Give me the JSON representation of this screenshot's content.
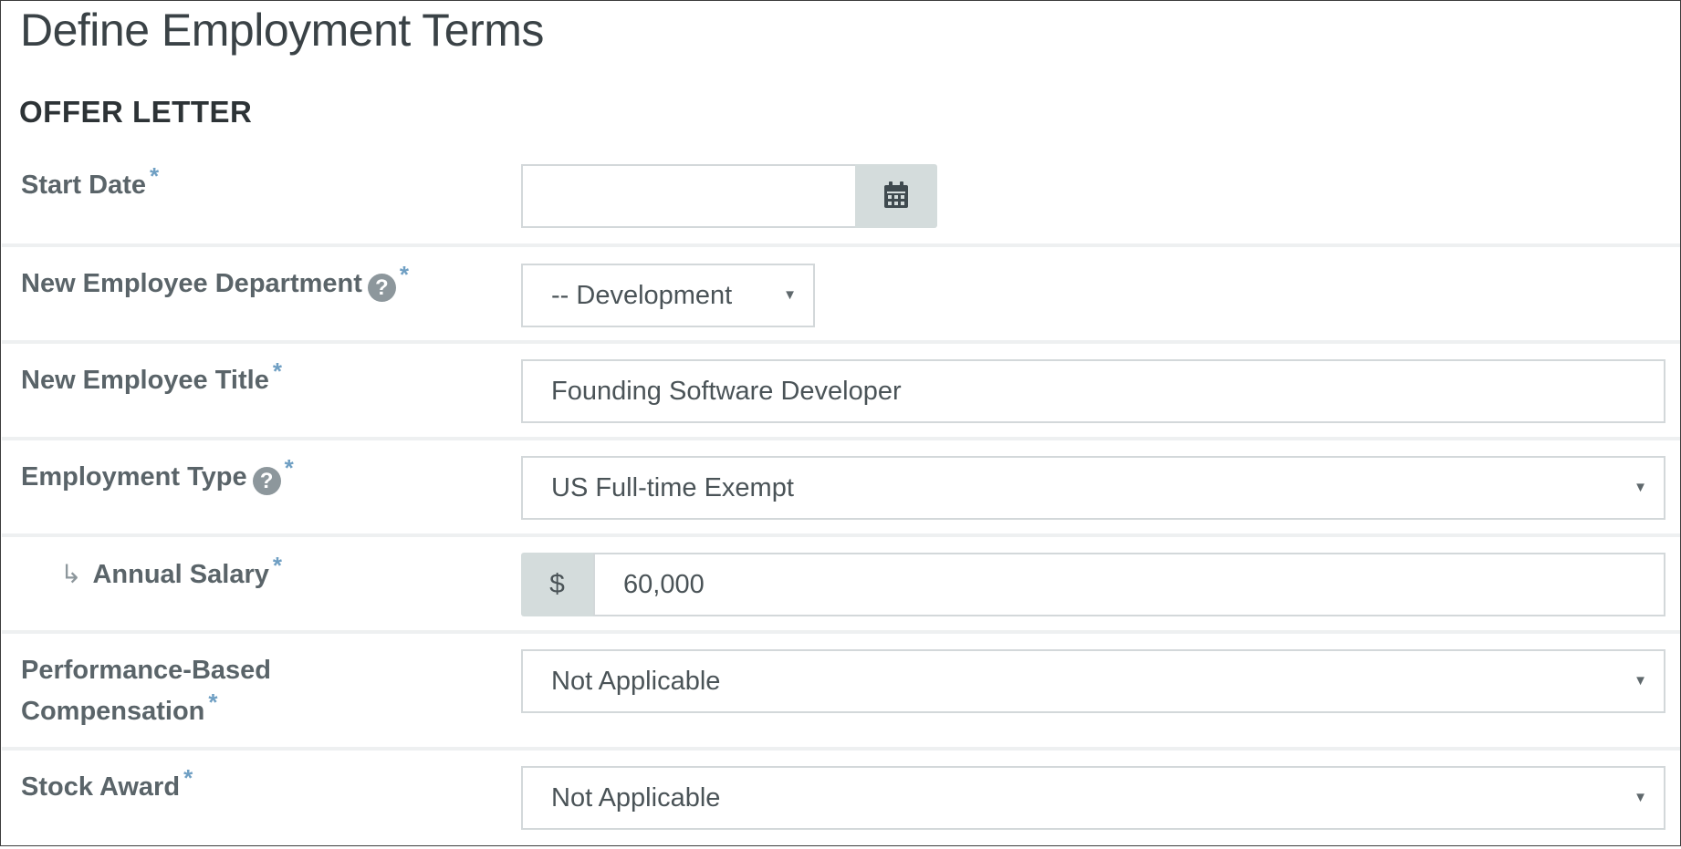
{
  "page": {
    "title": "Define Employment Terms",
    "section_title": "OFFER LETTER"
  },
  "form": {
    "required_marker": "*",
    "help_glyph": "?",
    "sub_arrow_glyph": "↳",
    "caret_glyph": "▼",
    "start_date": {
      "label": "Start Date",
      "value": "",
      "button_icon": "calendar-icon"
    },
    "department": {
      "label": "New Employee Department",
      "value": "-- Development"
    },
    "title": {
      "label": "New Employee Title",
      "value": "Founding Software Developer"
    },
    "employment_type": {
      "label": "Employment Type",
      "value": "US Full-time Exempt"
    },
    "annual_salary": {
      "label": "Annual Salary",
      "currency": "$",
      "value": "60,000"
    },
    "performance_compensation": {
      "label_line1": "Performance-Based",
      "label_line2": "Compensation",
      "value": "Not Applicable"
    },
    "stock_award": {
      "label": "Stock Award",
      "value": "Not Applicable"
    }
  },
  "colors": {
    "required": "#6f9fc3",
    "addon_bg": "#d4dcdc",
    "label_text": "#5a6469",
    "row_divider": "#eef0f1"
  }
}
